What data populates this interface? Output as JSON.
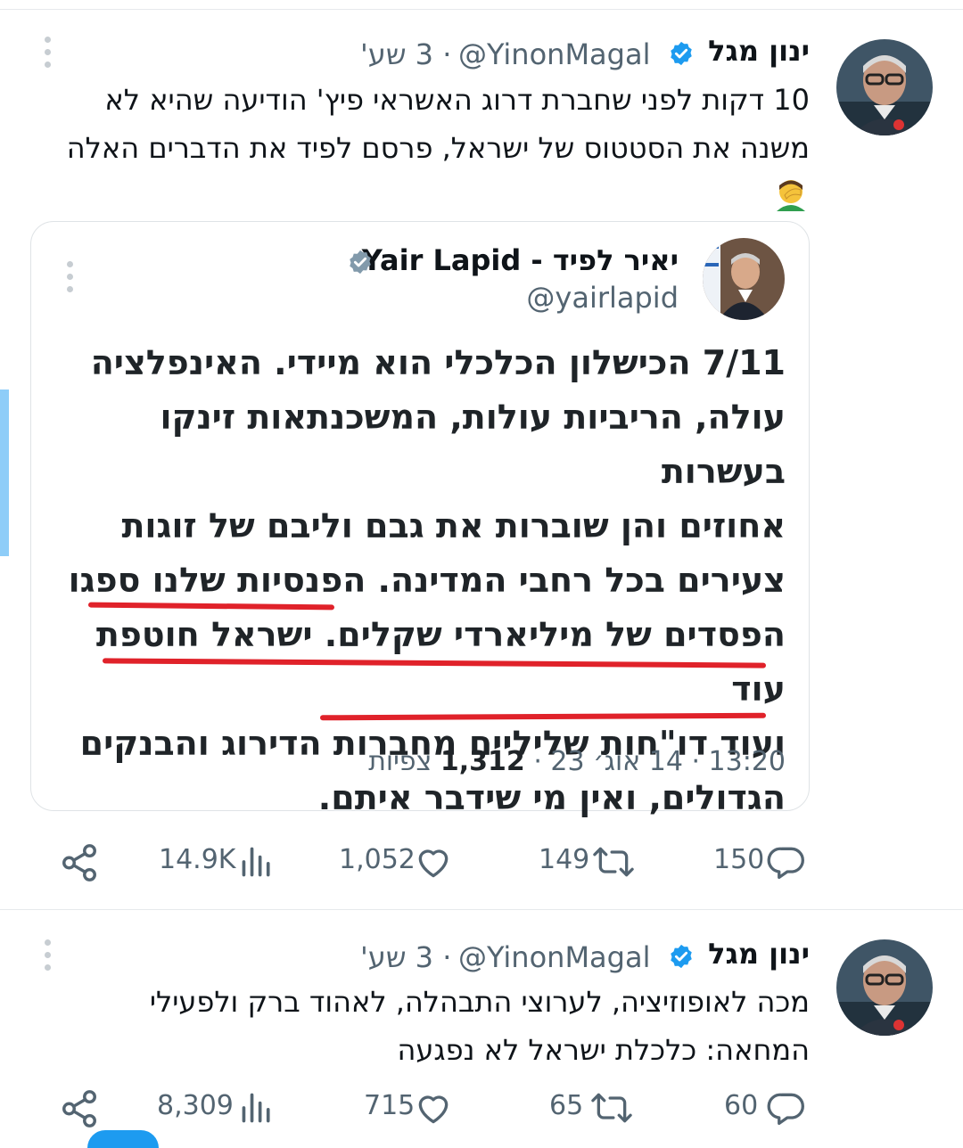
{
  "tweet1": {
    "author_name": "ינון מגל",
    "handle": "@YinonMagal",
    "time": "· 3 שע'",
    "text_line1": "10 דקות לפני שחברת דרוג האשראי פיץ' הודיעה שהיא לא",
    "text_line2": "משנה את הסטטוס של ישראל, פרסם לפיד את הדברים האלה",
    "emoji": "🤦‍♂️",
    "quote": {
      "author_name": "יאיר לפיד - Yair Lapid",
      "handle": "@yairlapid",
      "lines": [
        "7/11 הכישלון הכלכלי הוא מיידי. האינפלציה",
        "עולה, הריביות עולות, המשכנתאות זינקו בעשרות",
        "אחוזים והן שוברות את גבם וליבם של זוגות",
        "צעירים בכל רחבי המדינה. הפנסיות שלנו ספגו",
        "הפסדים של מיליארדי שקלים. ישראל חוטפת עוד",
        "ועוד דו\"חות שליליים מחברות הדירוג והבנקים",
        "הגדולים, ואין מי שידבר איתם."
      ],
      "footer_time": "13:20 · 14 אוג׳ 23 ·",
      "footer_views": "1,312",
      "footer_views_label": "צפיות"
    },
    "actions": {
      "replies": "150",
      "retweets": "149",
      "likes": "1,052",
      "views": "14.9K"
    }
  },
  "tweet2": {
    "author_name": "ינון מגל",
    "handle": "@YinonMagal",
    "time": "· 3 שע'",
    "text_line1": "מכה לאופוזיציה, לערוצי התבהלה, לאהוד ברק ולפעילי",
    "text_line2": "המחאה: כלכלת ישראל לא נפגעה",
    "actions": {
      "replies": "60",
      "retweets": "65",
      "likes": "715",
      "views": "8,309"
    }
  },
  "colors": {
    "verified_blue": "#1d9bf0",
    "verified_gray": "#829aab",
    "underline_red": "#e0222a",
    "muted": "#536471"
  },
  "icons": [
    "more-icon",
    "verified-badge-icon",
    "reply-icon",
    "retweet-icon",
    "like-icon",
    "views-icon",
    "share-icon"
  ]
}
